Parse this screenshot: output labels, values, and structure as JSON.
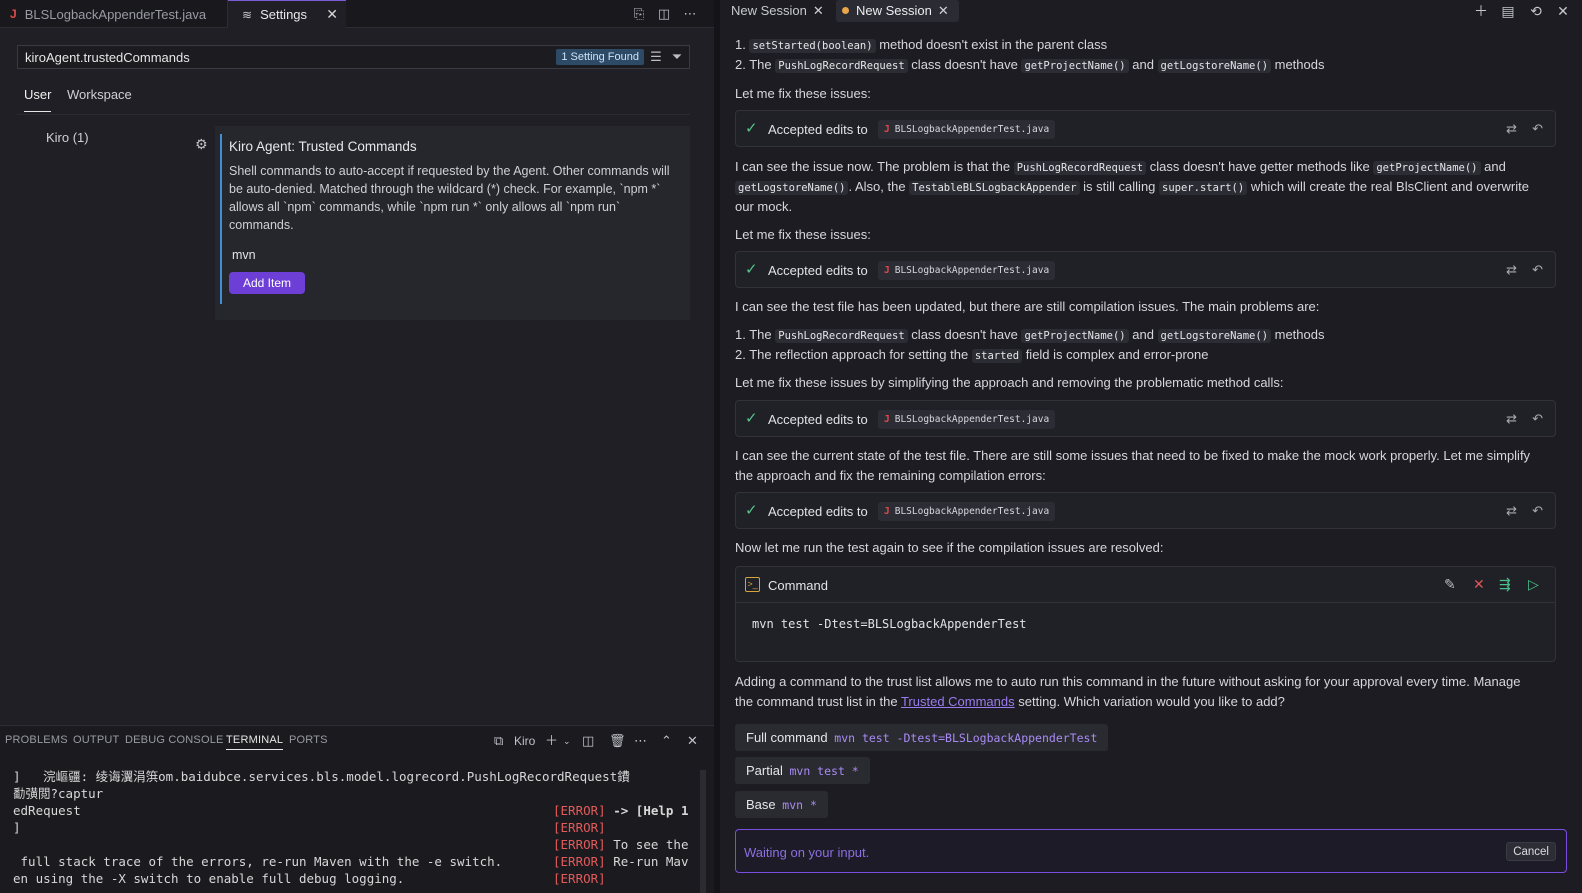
{
  "editor_tabs": [
    {
      "label": "BLSLogbackAppenderTest.java"
    },
    {
      "label": "Settings"
    }
  ],
  "settings": {
    "search_value": "kiroAgent.trustedCommands",
    "found_badge": "1 Setting Found",
    "scopes": [
      "User",
      "Workspace"
    ],
    "tree_item": "Kiro (1)",
    "setting_title": "Kiro Agent: Trusted Commands",
    "setting_description": "Shell commands to auto-accept if requested by the Agent. Other commands will be auto-denied. Matched through the wildcard (*) check. For example, `npm *` allows all `npm` commands, while `npm run *` only allows all `npm run` commands.",
    "setting_value": "mvn",
    "add_item_label": "Add Item"
  },
  "panel": {
    "tabs": [
      "PROBLEMS",
      "OUTPUT",
      "DEBUG CONSOLE",
      "TERMINAL",
      "PORTS"
    ],
    "active_tab": "TERMINAL",
    "terminal_name": "Kiro",
    "terminal_lines_left": [
      "]   浣嶇疆: 绫诲瀷涓篊om.baidubce.services.bls.model.logrecord.PushLogRecordRequest鐨",
      "勫彉閲?captur",
      "edRequest",
      "]",
      "",
      " full stack trace of the errors, re-run Maven with the -e switch.",
      "en using the -X switch to enable full debug logging."
    ],
    "terminal_lines_right": [
      {
        "tag": "[ERROR]",
        "text": " -> [Help 1"
      },
      {
        "tag": "[ERROR]",
        "text": ""
      },
      {
        "tag": "[ERROR]",
        "text": " To see the"
      },
      {
        "tag": "[ERROR]",
        "text": " Re-run Mav"
      },
      {
        "tag": "[ERROR]",
        "text": ""
      }
    ]
  },
  "chat": {
    "tabs": [
      {
        "label": "New Session"
      },
      {
        "label": "New Session"
      }
    ],
    "list1": [
      {
        "num": "1.",
        "code": "setStarted(boolean)",
        "text": " method doesn't exist in the parent class"
      },
      {
        "num": "2.",
        "pre": "The ",
        "code": "PushLogRecordRequest",
        "mid": " class doesn't have ",
        "code2": "getProjectName()",
        "mid2": " and ",
        "code3": "getLogstoreName()",
        "post": " methods"
      }
    ],
    "fix1": "Let me fix these issues:",
    "accepted_label": "Accepted edits to",
    "file_name": "BLSLogbackAppenderTest.java",
    "para2_a": "I can see the issue now. The problem is that the ",
    "para2_code1": "PushLogRecordRequest",
    "para2_b": " class doesn't have getter methods like ",
    "para2_code2": "getProjectName()",
    "para2_c": " and",
    "para2_code3": "getLogstoreName()",
    "para2_d": ". Also, the ",
    "para2_code4": "TestableBLSLogbackAppender",
    "para2_e": " is still calling ",
    "para2_code5": "super.start()",
    "para2_f": " which will create the real BlsClient and overwrite",
    "para2_g": "our mock.",
    "fix2": "Let me fix these issues:",
    "para3": "I can see the test file has been updated, but there are still compilation issues. The main problems are:",
    "list2_1_pre": "The ",
    "list2_1_code": "PushLogRecordRequest",
    "list2_1_mid": " class doesn't have ",
    "list2_1_code2": "getProjectName()",
    "list2_1_mid2": " and ",
    "list2_1_code3": "getLogstoreName()",
    "list2_1_post": " methods",
    "list2_2_pre": "The reflection approach for setting the ",
    "list2_2_code": "started",
    "list2_2_post": " field is complex and error-prone",
    "fix3": "Let me fix these issues by simplifying the approach and removing the problematic method calls:",
    "para4_a": "I can see the current state of the test file. There are still some issues that need to be fixed to make the mock work properly. Let me simplify",
    "para4_b": "the approach and fix the remaining compilation errors:",
    "para5": "Now let me run the test again to see if the compilation issues are resolved:",
    "command_title": "Command",
    "command_text": "mvn test -Dtest=BLSLogbackAppenderTest",
    "trust_a": "Adding a command to the trust list allows me to auto run this command in the future without asking for your approval every time. Manage",
    "trust_b": "the command trust list in the ",
    "trust_link": "Trusted Commands",
    "trust_c": " setting. Which variation would you like to add?",
    "options": [
      {
        "label": "Full command",
        "cmd": "mvn test -Dtest=BLSLogbackAppenderTest"
      },
      {
        "label": "Partial",
        "cmd": "mvn test *"
      },
      {
        "label": "Base",
        "cmd": "mvn *"
      }
    ],
    "waiting_text": "Waiting on your input.",
    "cancel_label": "Cancel"
  }
}
